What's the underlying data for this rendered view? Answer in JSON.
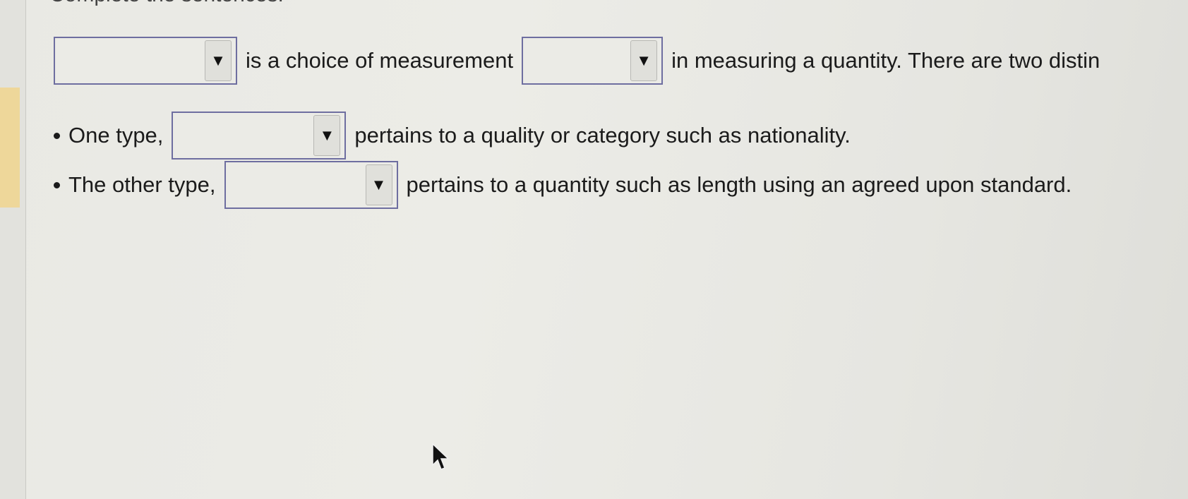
{
  "instruction": "Complete the sentences.",
  "sentence1": {
    "middle_text": "is a choice of measurement",
    "end_text": "in measuring a quantity. There are two distin"
  },
  "bullet1": {
    "prefix": "One type,",
    "suffix": "pertains to a quality or category such as nationality."
  },
  "bullet2": {
    "prefix": "The other type,",
    "suffix": "pertains to a quantity such as length using an agreed upon standard."
  },
  "dropdowns": [
    {
      "selected": "",
      "icon": "chevron-down-icon"
    },
    {
      "selected": "",
      "icon": "chevron-down-icon"
    },
    {
      "selected": "",
      "icon": "chevron-down-icon"
    },
    {
      "selected": "",
      "icon": "chevron-down-icon"
    }
  ],
  "colors": {
    "dropdown_border": "#6e6ea0",
    "accent_strip": "#eed79a"
  }
}
